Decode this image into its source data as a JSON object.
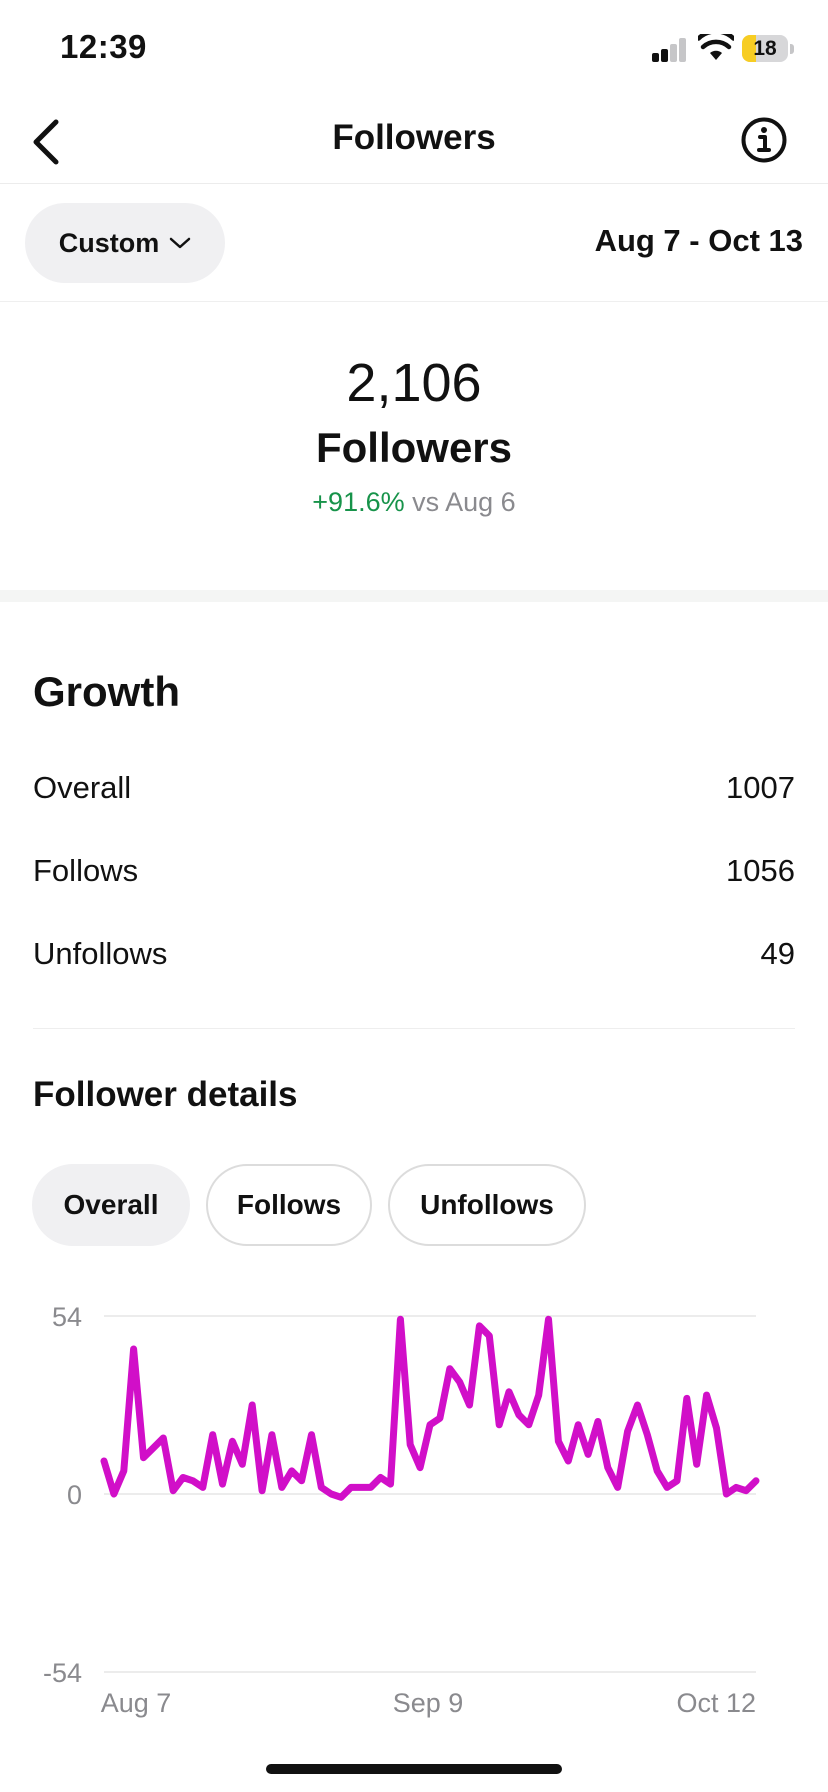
{
  "status_bar": {
    "time": "12:39",
    "battery": "18",
    "battery_level": 0.18
  },
  "header": {
    "title": "Followers",
    "back_icon": "chevron-left-icon",
    "info_icon": "info-circle-icon"
  },
  "filter": {
    "range_type": "Custom",
    "date_range": "Aug 7 - Oct 13"
  },
  "summary": {
    "count": "2,106",
    "label": "Followers",
    "change": "+91.6%",
    "compare": "vs Aug 6"
  },
  "growth": {
    "title": "Growth",
    "rows": [
      {
        "label": "Overall",
        "value": "1007"
      },
      {
        "label": "Follows",
        "value": "1056"
      },
      {
        "label": "Unfollows",
        "value": "49"
      }
    ]
  },
  "details": {
    "title": "Follower details",
    "tabs": [
      {
        "label": "Overall",
        "active": true
      },
      {
        "label": "Follows",
        "active": false
      },
      {
        "label": "Unfollows",
        "active": false
      }
    ]
  },
  "colors": {
    "accent_line": "#d10fc8",
    "positive": "#17934a",
    "muted": "#8a8a8e"
  },
  "chart_data": {
    "type": "line",
    "ylim": [
      -54,
      54
    ],
    "yticks": [
      "54",
      "0",
      "-54"
    ],
    "xticks": [
      "Aug 7",
      "Sep 9",
      "Oct 12"
    ],
    "grid": true,
    "series": [
      {
        "values": [
          10,
          0,
          7,
          44,
          11,
          14,
          17,
          1,
          5,
          4,
          2,
          18,
          3,
          16,
          9,
          27,
          1,
          18,
          2,
          7,
          4,
          18,
          2,
          0,
          -1,
          2,
          2,
          2,
          5,
          3,
          53,
          15,
          8,
          21,
          23,
          38,
          34,
          27,
          51,
          48,
          21,
          31,
          24,
          21,
          30,
          53,
          16,
          10,
          21,
          12,
          22,
          8,
          2,
          19,
          27,
          18,
          7,
          2,
          4,
          29,
          9,
          30,
          20,
          0,
          2,
          1,
          4
        ]
      }
    ]
  }
}
